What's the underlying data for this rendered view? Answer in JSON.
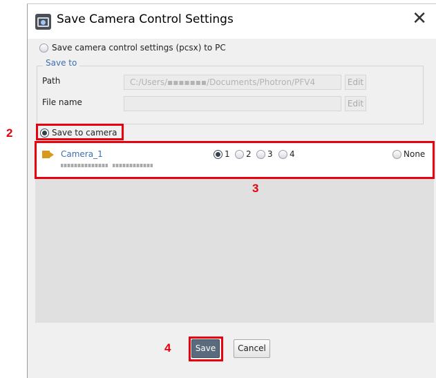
{
  "dialog": {
    "title": "Save Camera Control Settings",
    "close_glyph": "✕",
    "save_to_pc_label": "Save camera control settings (pcsx) to PC",
    "save_to_legend": "Save to",
    "path_label": "Path",
    "path_value": "C:/Users/▪▪▪▪▪▪▪/Documents/Photron/PFV4",
    "file_name_label": "File name",
    "file_name_value": "",
    "edit_label": "Edit",
    "save_to_camera_label": "Save to camera",
    "camera": {
      "name": "Camera_1",
      "slots": [
        "1",
        "2",
        "3",
        "4"
      ],
      "selected_slot": "1",
      "none_label": "None"
    },
    "save_button": "Save",
    "cancel_button": "Cancel"
  },
  "annotations": {
    "step2": "2",
    "step3": "3",
    "step4": "4",
    "highlight_color": "#e8000d"
  },
  "icons": {
    "app": "camera-app-icon",
    "close": "close-icon",
    "camera": "video-camera-icon"
  }
}
